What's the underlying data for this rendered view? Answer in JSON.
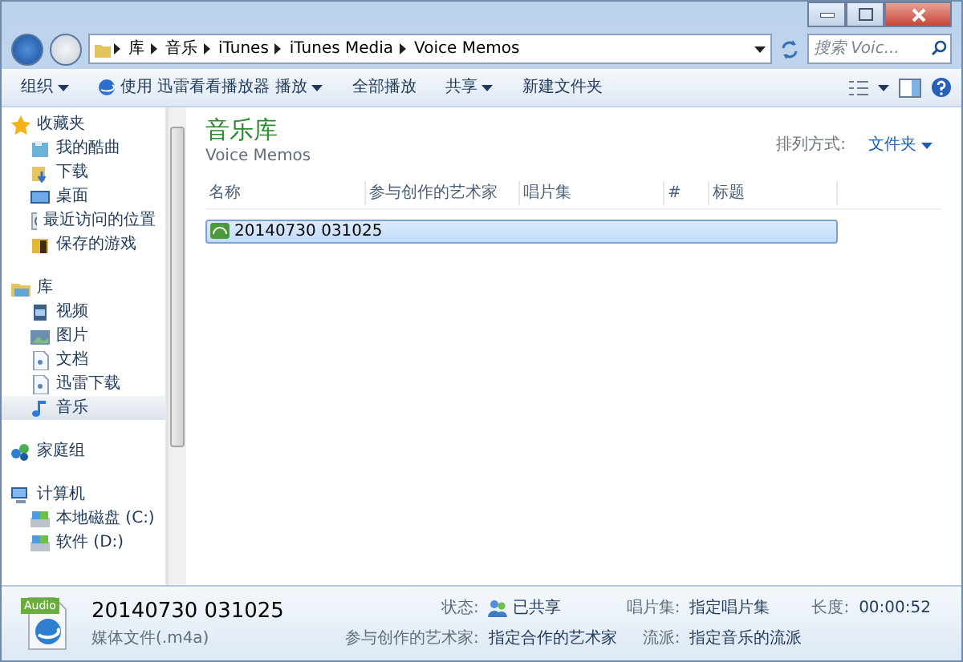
{
  "address": {
    "breadcrumbs": [
      "库",
      "音乐",
      "iTunes",
      "iTunes Media",
      "Voice Memos"
    ]
  },
  "search": {
    "placeholder": "搜索 Voic..."
  },
  "toolbar": [
    {
      "label": "组织",
      "dropdown": true,
      "kind": "plain"
    },
    {
      "label": "使用 迅雷看看播放器 播放",
      "dropdown": true,
      "kind": "player"
    },
    {
      "label": "全部播放",
      "dropdown": false,
      "kind": "plain"
    },
    {
      "label": "共享",
      "dropdown": true,
      "kind": "plain"
    },
    {
      "label": "新建文件夹",
      "dropdown": false,
      "kind": "plain"
    }
  ],
  "nav": [
    {
      "label": "收藏夹",
      "kind": "star",
      "selected": false,
      "children": [
        {
          "label": "我的酷曲",
          "kind": "music-folder",
          "selected": false
        },
        {
          "label": "下载",
          "kind": "download",
          "selected": false
        },
        {
          "label": "桌面",
          "kind": "desktop",
          "selected": false
        },
        {
          "label": "最近访问的位置",
          "kind": "recent",
          "selected": false
        },
        {
          "label": "保存的游戏",
          "kind": "games",
          "selected": false
        }
      ]
    },
    {
      "label": "库",
      "kind": "library",
      "selected": false,
      "children": [
        {
          "label": "视频",
          "kind": "video",
          "selected": false
        },
        {
          "label": "图片",
          "kind": "picture",
          "selected": false
        },
        {
          "label": "文档",
          "kind": "document",
          "selected": false
        },
        {
          "label": "迅雷下载",
          "kind": "document",
          "selected": false
        },
        {
          "label": "音乐",
          "kind": "music",
          "selected": true
        }
      ]
    },
    {
      "label": "家庭组",
      "kind": "homegroup",
      "selected": false
    },
    {
      "label": "计算机",
      "kind": "computer",
      "selected": false,
      "children": [
        {
          "label": "本地磁盘 (C:)",
          "kind": "drive",
          "selected": false
        },
        {
          "label": "软件 (D:)",
          "kind": "drive",
          "selected": false
        }
      ]
    }
  ],
  "library": {
    "title": "音乐库",
    "subtitle": "Voice Memos",
    "arrange_label": "排列方式:",
    "arrange_value": "文件夹"
  },
  "columns": [
    "名称",
    "参与创作的艺术家",
    "唱片集",
    "#",
    "标题"
  ],
  "files": [
    {
      "name": "20140730 031025",
      "selected": true
    }
  ],
  "details": {
    "name": "20140730 031025",
    "type": "媒体文件(.m4a)",
    "badge": "Audio",
    "fields": [
      {
        "label": "状态:",
        "value": "已共享",
        "kind": "shared"
      },
      {
        "label": "参与创作的艺术家:",
        "value": "指定合作的艺术家",
        "kind": "plain"
      },
      {
        "label": "唱片集:",
        "value": "指定唱片集",
        "kind": "plain"
      },
      {
        "label": "流派:",
        "value": "指定音乐的流派",
        "kind": "plain"
      },
      {
        "label": "长度:",
        "value": "00:00:52",
        "kind": "plain"
      }
    ]
  }
}
